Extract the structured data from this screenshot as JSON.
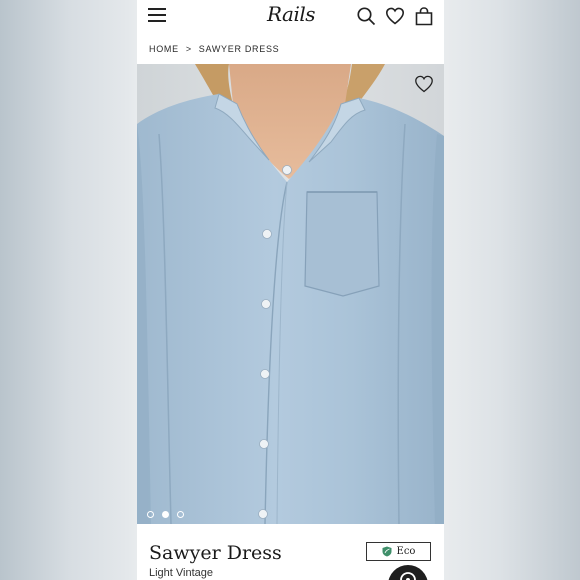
{
  "header": {
    "logo_text": "Rails",
    "icons": [
      "menu-icon",
      "search-icon",
      "heart-icon",
      "bag-icon"
    ]
  },
  "breadcrumb": {
    "home": "HOME",
    "separator": ">",
    "current": "SAWYER DRESS"
  },
  "gallery": {
    "image_count": 3,
    "active_index": 1
  },
  "product": {
    "title": "Sawyer Dress",
    "color": "Light Vintage",
    "badge_label": "Eco"
  },
  "colors": {
    "shirt": "#a9c3d8",
    "eco_leaf": "#3f8f6a",
    "chat_button": "#1f1f1f"
  }
}
